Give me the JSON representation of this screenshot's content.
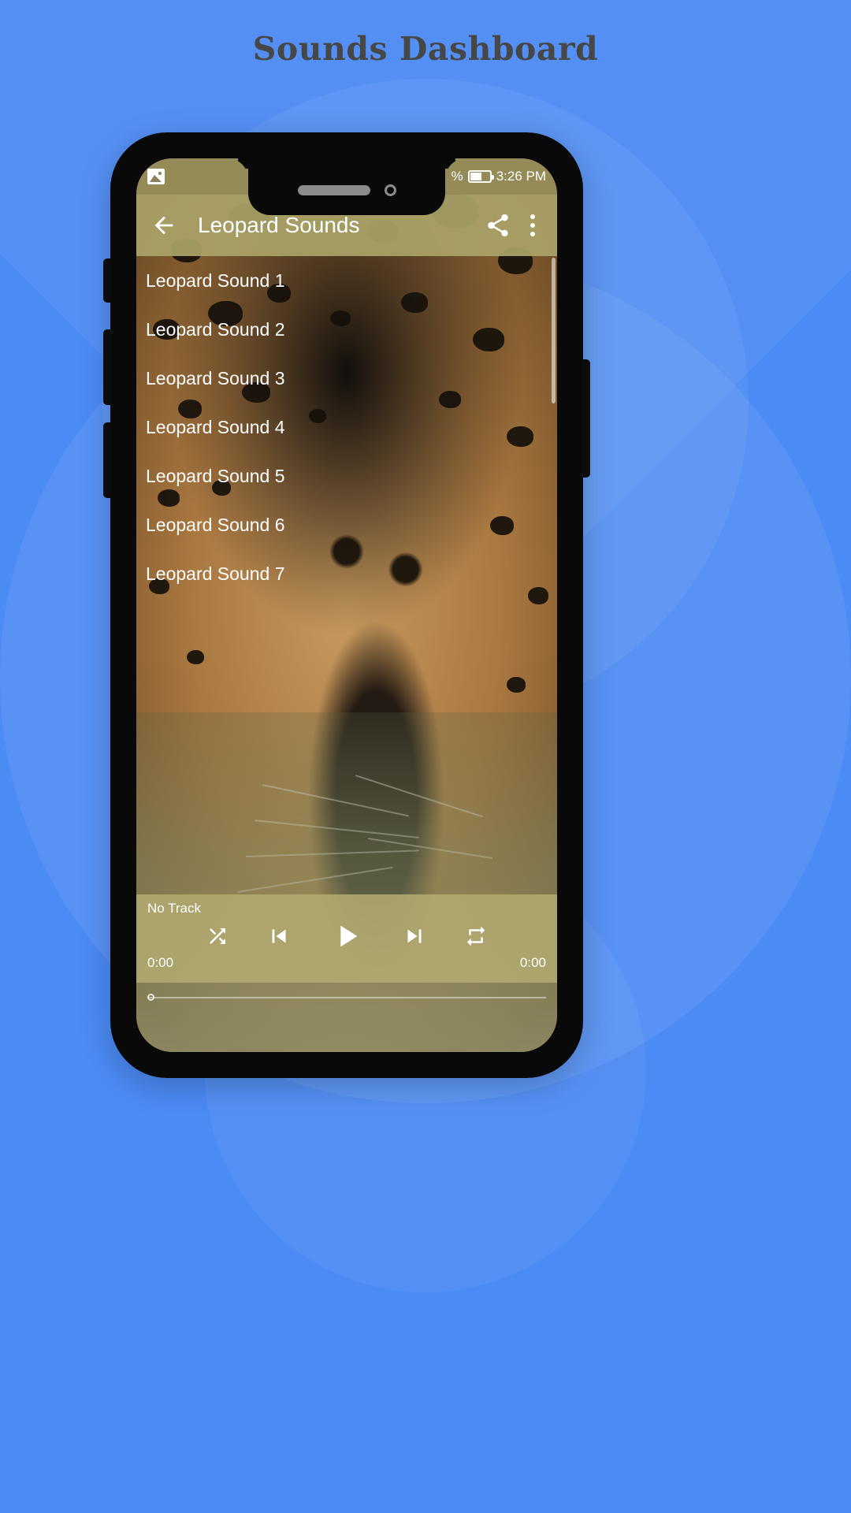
{
  "page": {
    "title": "Sounds Dashboard",
    "background_color": "#4b8bf4",
    "title_color": "#474747"
  },
  "device": {
    "frame_color": "#090909",
    "notch": {
      "speaker_icon": "speaker-grille",
      "camera_icon": "front-camera"
    },
    "buttons": [
      "mute-switch",
      "volume-up",
      "volume-down",
      "power"
    ]
  },
  "status_bar": {
    "left_icon": "image-icon",
    "battery_percent": "%",
    "battery_icon": "battery-icon",
    "time": "3:26 PM"
  },
  "toolbar": {
    "back_icon": "back-arrow-icon",
    "title": "Leopard Sounds",
    "share_icon": "share-icon",
    "overflow_icon": "overflow-menu-icon"
  },
  "sound_list": {
    "items": [
      {
        "label": "Leopard Sound 1"
      },
      {
        "label": "Leopard Sound 2"
      },
      {
        "label": "Leopard Sound 3"
      },
      {
        "label": "Leopard Sound 4"
      },
      {
        "label": "Leopard Sound 5"
      },
      {
        "label": "Leopard Sound 6"
      },
      {
        "label": "Leopard Sound 7"
      }
    ]
  },
  "player": {
    "track_title": "No Track",
    "shuffle_icon": "shuffle-icon",
    "previous_icon": "skip-previous-icon",
    "play_icon": "play-icon",
    "next_icon": "skip-next-icon",
    "repeat_icon": "repeat-icon",
    "elapsed_time": "0:00",
    "total_time": "0:00",
    "seek_position_percent": 0
  },
  "colors": {
    "app_accent": "#b2aa71",
    "toolbar": "#aaa268",
    "status_bar": "#968e5c",
    "text_on_accent": "#ffffff"
  }
}
